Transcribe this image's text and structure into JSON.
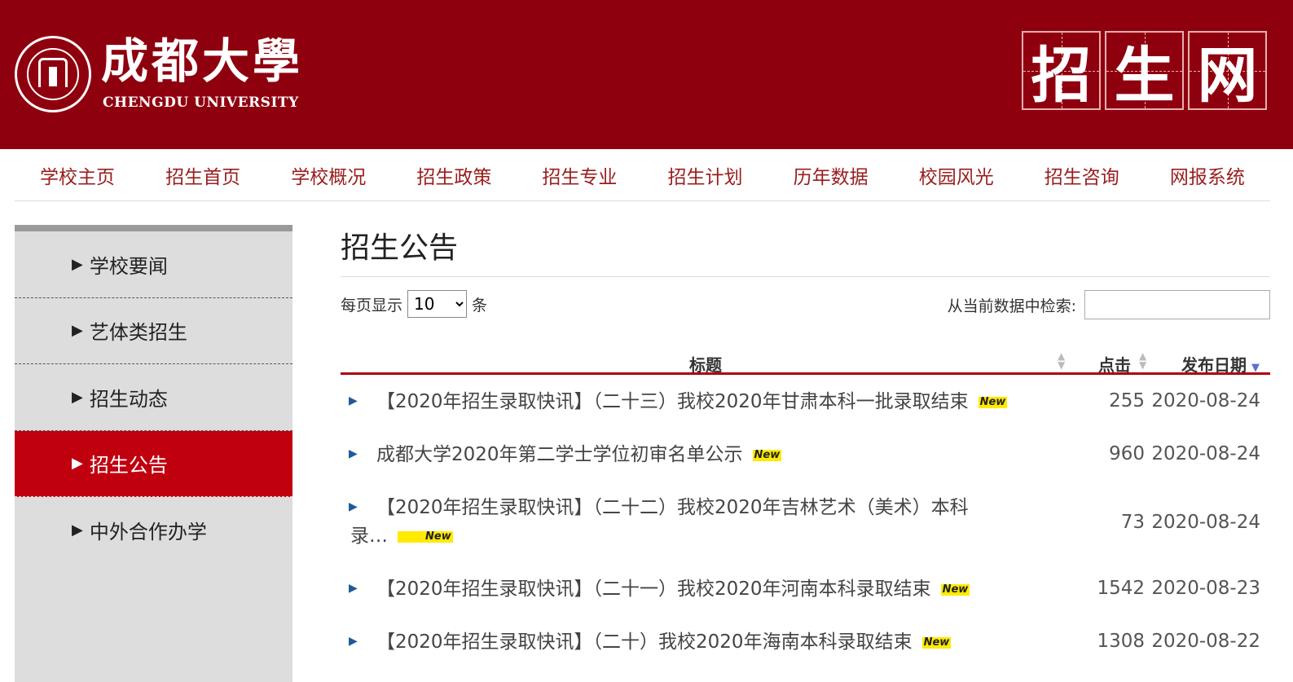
{
  "header": {
    "logo_cn": "成都大學",
    "logo_en": "CHENGDU UNIVERSITY",
    "banner_chars": [
      "招",
      "生",
      "网"
    ]
  },
  "nav": [
    "学校主页",
    "招生首页",
    "学校概况",
    "招生政策",
    "招生专业",
    "招生计划",
    "历年数据",
    "校园风光",
    "招生咨询",
    "网报系统"
  ],
  "sidebar": {
    "items": [
      "学校要闻",
      "艺体类招生",
      "招生动态",
      "招生公告",
      "中外合作办学"
    ],
    "active": "招生公告"
  },
  "main": {
    "title": "招生公告",
    "length_label_before": "每页显示",
    "length_value": "10",
    "length_label_after": "条",
    "search_label": "从当前数据中检索:",
    "columns": {
      "title": "标题",
      "clicks": "点击",
      "date": "发布日期"
    },
    "new_badge": "New",
    "rows": [
      {
        "title": "【2020年招生录取快讯】（二十三）我校2020年甘肃本科一批录取结束",
        "clicks": "255",
        "date": "2020-08-24",
        "tall": false
      },
      {
        "title": "成都大学2020年第二学士学位初审名单公示",
        "clicks": "960",
        "date": "2020-08-24",
        "tall": false
      },
      {
        "title": "【2020年招生录取快讯】（二十二）我校2020年吉林艺术（美术）本科录…",
        "clicks": "73",
        "date": "2020-08-24",
        "tall": true
      },
      {
        "title": "【2020年招生录取快讯】（二十一）我校2020年河南本科录取结束",
        "clicks": "1542",
        "date": "2020-08-23",
        "tall": false
      },
      {
        "title": "【2020年招生录取快讯】（二十）我校2020年海南本科录取结束",
        "clicks": "1308",
        "date": "2020-08-22",
        "tall": false
      }
    ]
  },
  "colors": {
    "header_bg": "#8f000f",
    "accent": "#c0000f",
    "nav_text": "#9a1d1d"
  }
}
